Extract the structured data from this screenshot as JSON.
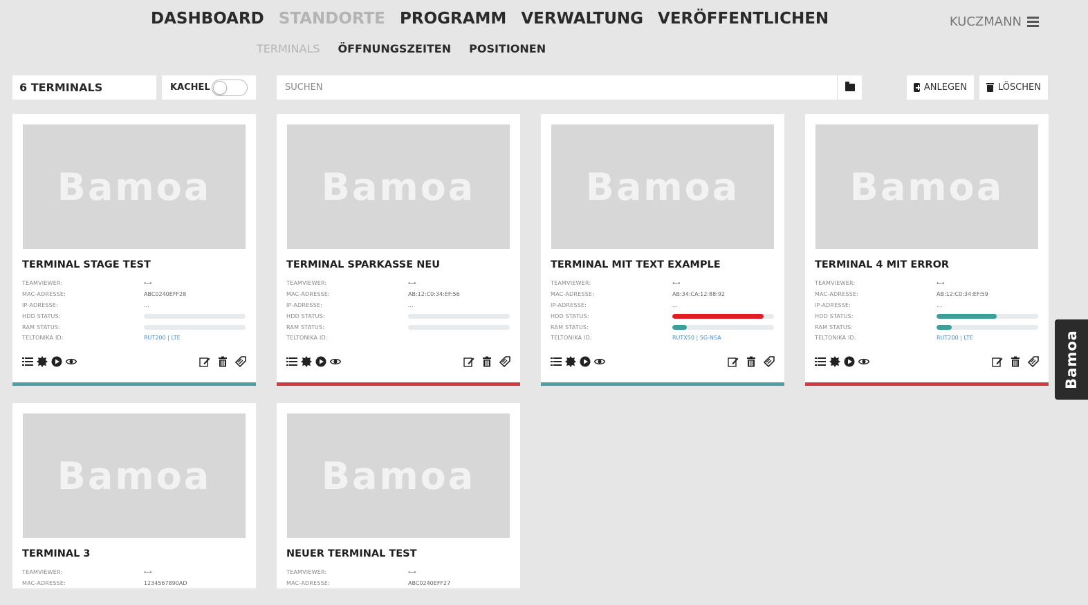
{
  "nav": {
    "main": [
      "DASHBOARD",
      "STANDORTE",
      "PROGRAMM",
      "VERWALTUNG",
      "VERÖFFENTLICHEN"
    ],
    "active_main": "STANDORTE",
    "sub": [
      "TERMINALS",
      "ÖFFNUNGSZEITEN",
      "POSITIONEN"
    ],
    "active_sub": "TERMINALS",
    "user": "KUCZMANN"
  },
  "toolbar": {
    "count_label": "6 TERMINALS",
    "kachel_label": "KACHEL",
    "kachel_on": false,
    "search_placeholder": "SUCHEN",
    "add_label": "ANLEGEN",
    "delete_label": "LÖSCHEN"
  },
  "labels": {
    "teamviewer": "TEAMVIEWER:",
    "mac": "MAC-ADRESSE:",
    "ip": "IP-ADRESSE:",
    "hdd": "HDD STATUS:",
    "ram": "RAM STATUS:",
    "teltonika": "TELTONIKA ID:"
  },
  "thumb_logo": "Bamoa",
  "brand": "Bamoa",
  "colors": {
    "teal": "#4aa3a3",
    "red": "#cf3b47",
    "bar_red": "#e31b23",
    "bar_teal": "#3f9e9c"
  },
  "terminals": [
    {
      "title": "TERMINAL STAGE TEST",
      "teamviewer": "⟷",
      "mac": "ABC0240EFF28",
      "ip": "...",
      "hdd": 0,
      "ram": 0,
      "teltonika": "RUT200 | LTE",
      "status": "teal"
    },
    {
      "title": "TERMINAL SPARKASSE NEU",
      "teamviewer": "⟷",
      "mac": "AB:12:C0:34:EF:56",
      "ip": "...",
      "hdd": 0,
      "ram": 0,
      "teltonika": "",
      "status": "red"
    },
    {
      "title": "TERMINAL MIT TEXT EXAMPLE",
      "teamviewer": "⟷",
      "mac": "AB:34:CA:12:88:92",
      "ip": "...",
      "hdd": 0.9,
      "hdd_color": "red",
      "ram": 0.14,
      "ram_color": "teal",
      "teltonika": "RUTX50 | 5G-NSA",
      "status": "teal"
    },
    {
      "title": "TERMINAL 4 MIT ERROR",
      "teamviewer": "⟷",
      "mac": "AB:12:C0:34:EF:59",
      "ip": "...",
      "hdd": 0.59,
      "hdd_color": "teal",
      "ram": 0.15,
      "ram_color": "teal",
      "teltonika": "RUT200 | LTE",
      "status": "red"
    },
    {
      "title": "TERMINAL 3",
      "teamviewer": "⟷",
      "mac": "1234567890AD",
      "status": ""
    },
    {
      "title": "NEUER TERMINAL TEST",
      "teamviewer": "⟷",
      "mac": "ABC0240EFF27",
      "status": ""
    }
  ]
}
